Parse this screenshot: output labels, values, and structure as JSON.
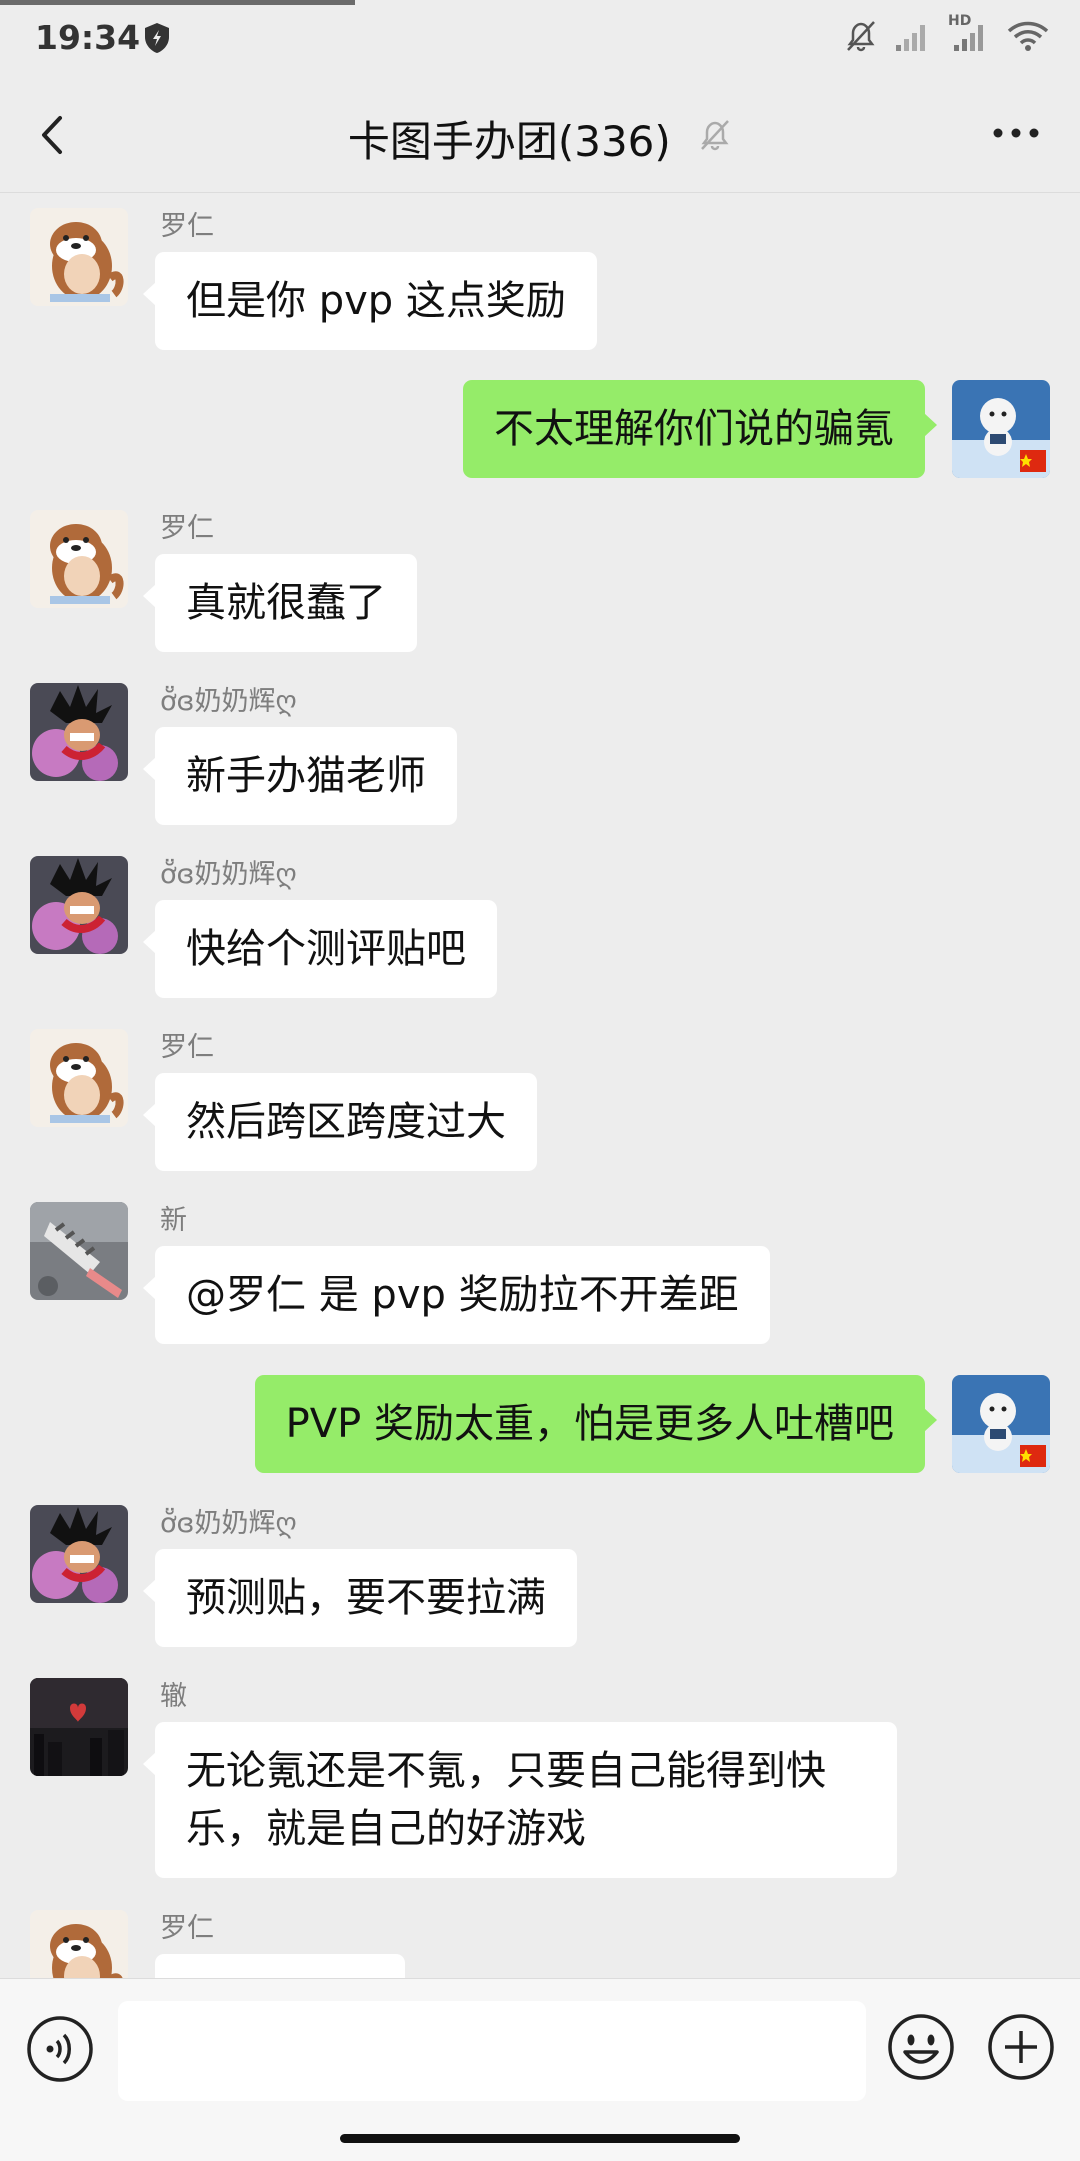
{
  "status_bar": {
    "time": "19:34",
    "network_label": "HD",
    "icons": [
      "shield-icon",
      "bell-muted-icon",
      "signal-icon",
      "signal-hd-icon",
      "wifi-icon"
    ]
  },
  "header": {
    "title": "卡图手办团(336)",
    "icons": [
      "back-icon",
      "bell-muted-icon",
      "more-icon"
    ]
  },
  "messages": [
    {
      "sender": "罗仁",
      "text": "但是你 pvp 这点奖励",
      "direction": "in"
    },
    {
      "sender": "",
      "text": "不太理解你们说的骗氪",
      "direction": "out"
    },
    {
      "sender": "罗仁",
      "text": "真就很蠢了",
      "direction": "in"
    },
    {
      "sender": "ơ̆̈ɞ奶奶辉ღ",
      "text": "新手办猫老师",
      "direction": "in"
    },
    {
      "sender": "ơ̆̈ɞ奶奶辉ღ",
      "text": "快给个测评贴吧",
      "direction": "in"
    },
    {
      "sender": "罗仁",
      "text": "然后跨区跨度过大",
      "direction": "in"
    },
    {
      "sender": "新",
      "text": "@罗仁  是 pvp 奖励拉不开差距",
      "direction": "in"
    },
    {
      "sender": "",
      "text": "PVP 奖励太重，怕是更多人吐槽吧",
      "direction": "out"
    },
    {
      "sender": "ơ̆̈ɞ奶奶辉ღ",
      "text": "预测贴，要不要拉满",
      "direction": "in"
    },
    {
      "sender": "辙",
      "text": "无论氪还是不氪，只要自己能得到快乐，就是自己的好游戏",
      "direction": "in"
    },
    {
      "sender": "罗仁",
      "text": "",
      "direction": "in"
    }
  ],
  "input_bar": {
    "icons": [
      "voice-icon",
      "emoji-icon",
      "plus-icon"
    ],
    "text_value": ""
  },
  "colors": {
    "background": "#ededed",
    "incoming_bubble": "#ffffff",
    "outgoing_bubble": "#95ec69"
  }
}
